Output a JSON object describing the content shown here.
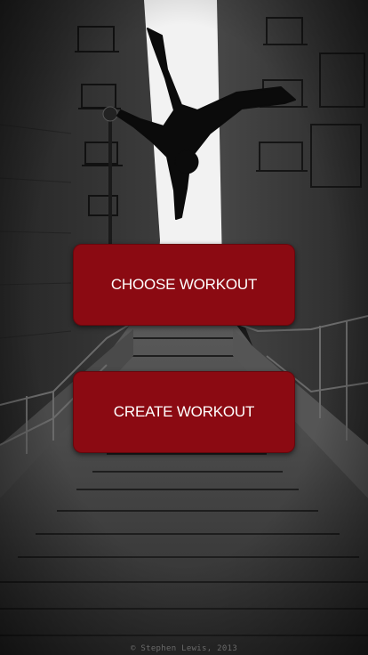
{
  "screen": {
    "background_image": "silhouette-of-person-handstand-over-city-alley-staircase"
  },
  "menu": {
    "choose_workout_label": "CHOOSE WORKOUT",
    "create_workout_label": "CREATE WORKOUT"
  },
  "footer": {
    "photo_credit": "© Stephen Lewis, 2013"
  },
  "colors": {
    "button_fill": "#8b0a12",
    "button_text": "#ffffff",
    "sky": "#f2f2f2"
  }
}
